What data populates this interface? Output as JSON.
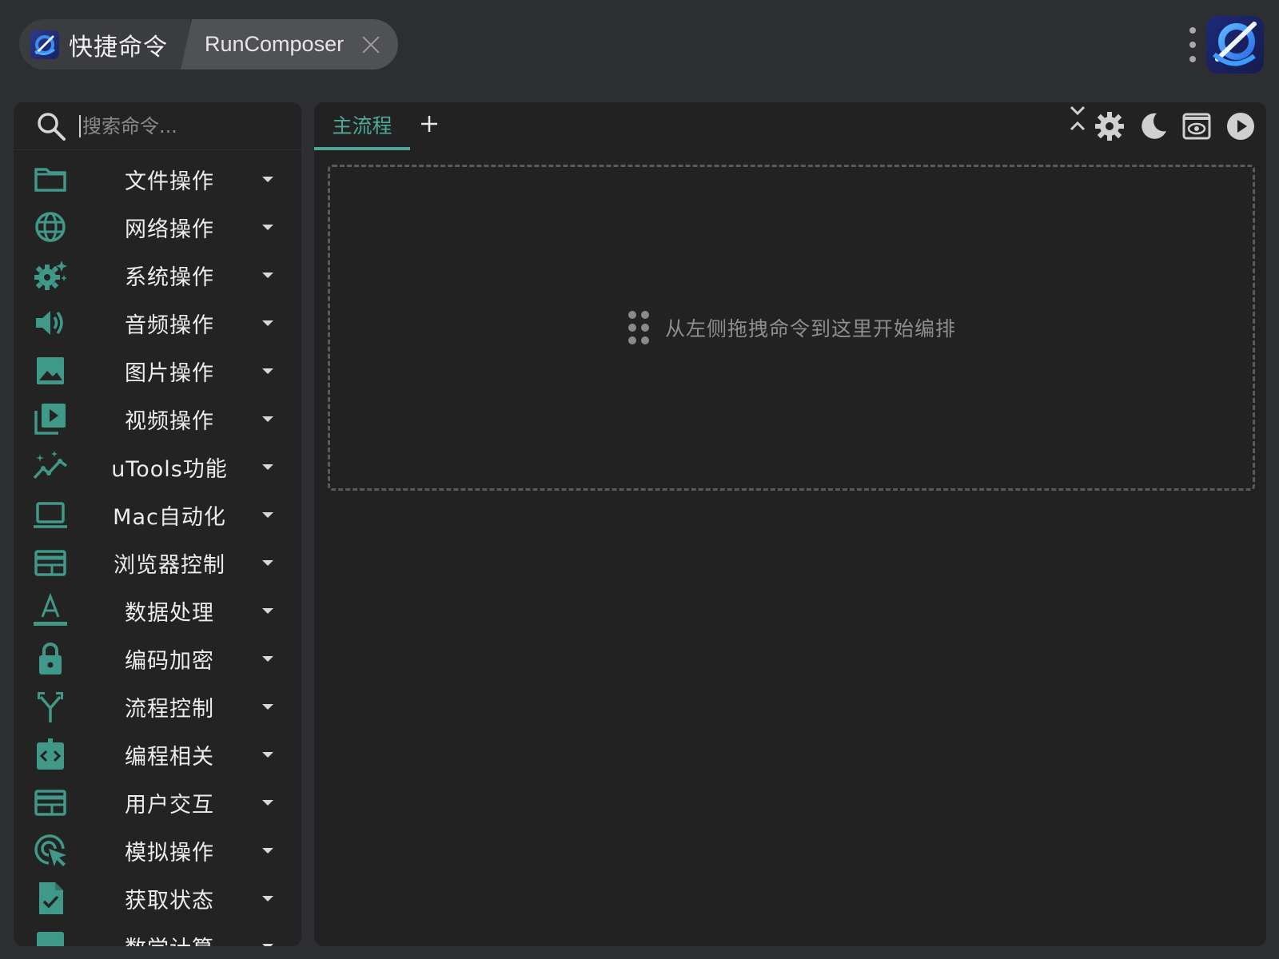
{
  "app": {
    "title": "快捷命令",
    "subtitle": "RunComposer"
  },
  "sidebar": {
    "search_placeholder": "搜索命令...",
    "categories": [
      {
        "label": "文件操作",
        "icon": "folder-icon"
      },
      {
        "label": "网络操作",
        "icon": "globe-icon"
      },
      {
        "label": "系统操作",
        "icon": "settings-sparkle-icon"
      },
      {
        "label": "音频操作",
        "icon": "speaker-icon"
      },
      {
        "label": "图片操作",
        "icon": "image-icon"
      },
      {
        "label": "视频操作",
        "icon": "video-library-icon"
      },
      {
        "label": "uTools功能",
        "icon": "sparkle-chart-icon"
      },
      {
        "label": "Mac自动化",
        "icon": "laptop-icon"
      },
      {
        "label": "浏览器控制",
        "icon": "browser-window-icon"
      },
      {
        "label": "数据处理",
        "icon": "text-format-icon"
      },
      {
        "label": "编码加密",
        "icon": "lock-icon"
      },
      {
        "label": "流程控制",
        "icon": "fork-arrow-icon"
      },
      {
        "label": "编程相关",
        "icon": "code-icon"
      },
      {
        "label": "用户交互",
        "icon": "window-icon"
      },
      {
        "label": "模拟操作",
        "icon": "cursor-click-icon"
      },
      {
        "label": "获取状态",
        "icon": "file-check-icon"
      },
      {
        "label": "数学计算",
        "icon": "calculator-icon"
      }
    ]
  },
  "main": {
    "tabs": [
      {
        "label": "主流程"
      }
    ],
    "dropzone_hint": "从左侧拖拽命令到这里开始编排"
  },
  "colors": {
    "accent": "#4ea898",
    "background": "#2d2e31",
    "panel": "#222222"
  }
}
